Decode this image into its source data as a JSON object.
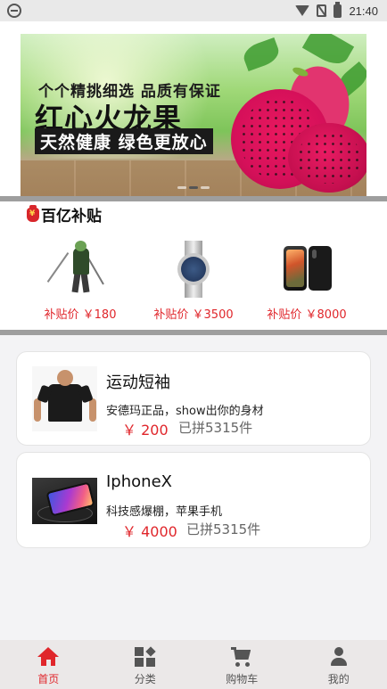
{
  "status_bar": {
    "time": "21:40"
  },
  "banner": {
    "line1": "个个精挑细选  品质有保证",
    "line2": "红心火龙果",
    "line3": "天然健康  绿色更放心"
  },
  "subsidy": {
    "title": "百亿补贴",
    "items": [
      {
        "price": "补贴价 ￥180",
        "icon": "figure"
      },
      {
        "price": "补贴价 ￥3500",
        "icon": "watch"
      },
      {
        "price": "补贴价 ￥8000",
        "icon": "phone"
      }
    ]
  },
  "products": [
    {
      "name": "运动短袖",
      "desc": "安德玛正品，show出你的身材",
      "price": "￥ 200",
      "sold": "已拼5315件"
    },
    {
      "name": "IphoneX",
      "desc": "科技感爆棚，苹果手机",
      "price": "￥ 4000",
      "sold": "已拼5315件"
    }
  ],
  "nav": {
    "items": [
      {
        "label": "首页",
        "icon": "home-icon",
        "active": true
      },
      {
        "label": "分类",
        "icon": "category-icon",
        "active": false
      },
      {
        "label": "购物车",
        "icon": "cart-icon",
        "active": false
      },
      {
        "label": "我的",
        "icon": "user-icon",
        "active": false
      }
    ]
  },
  "colors": {
    "accent": "#e0262b",
    "nav_bg": "#ebe8e8",
    "separator": "#9e9e9e"
  }
}
